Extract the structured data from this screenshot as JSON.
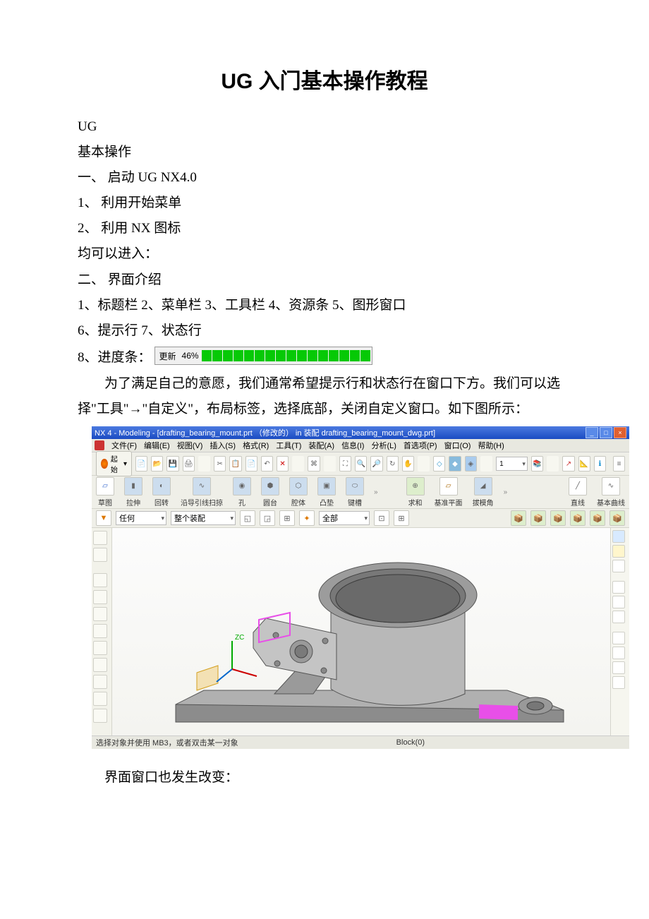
{
  "title": "UG 入门基本操作教程",
  "lines": {
    "l1": "UG",
    "l2": "基本操作",
    "l3": "一、 启动 UG NX4.0",
    "l4": "1、 利用开始菜单",
    "l5": "2、 利用 NX 图标",
    "l6": "均可以进入：",
    "l7": "二、 界面介绍",
    "l8": "1、标题栏  2、菜单栏  3、工具栏  4、资源条  5、图形窗口",
    "l9": "6、提示行  7、状态行",
    "progress_prefix": "8、进度条：",
    "progress_update": "更新",
    "progress_pct": "46%",
    "para1": "为了满足自己的意愿，我们通常希望提示行和状态行在窗口下方。我们可以选择\"工具\"→\"自定义\"，布局标签，选择底部，关闭自定义窗口。如下图所示：",
    "caption2": "界面窗口也发生改变："
  },
  "screenshot": {
    "window_title": "NX 4 - Modeling - [drafting_bearing_mount.prt （修改的）  in 装配 drafting_bearing_mount_dwg.prt]",
    "menus": [
      "文件(F)",
      "编辑(E)",
      "视图(V)",
      "插入(S)",
      "格式(R)",
      "工具(T)",
      "装配(A)",
      "信息(I)",
      "分析(L)",
      "首选项(P)",
      "窗口(O)",
      "帮助(H)"
    ],
    "start_label": "起始",
    "toolbar2_items": [
      "草图",
      "拉伸",
      "回转",
      "沿导引线扫掠",
      "孔",
      "圆台",
      "腔体",
      "凸垫",
      "键槽"
    ],
    "toolbar2_items_right": [
      "求和",
      "基准平面",
      "拔模角"
    ],
    "toolbar2_far_right": [
      "直线",
      "基本曲线"
    ],
    "filter_any": "任何",
    "filter_asm": "整个装配",
    "filter_all": "全部",
    "layer_value": "1",
    "status_left": "选择对象并使用 MB3，或者双击某一对象",
    "status_mid": "Block(0)",
    "axis_label": "ZC"
  }
}
